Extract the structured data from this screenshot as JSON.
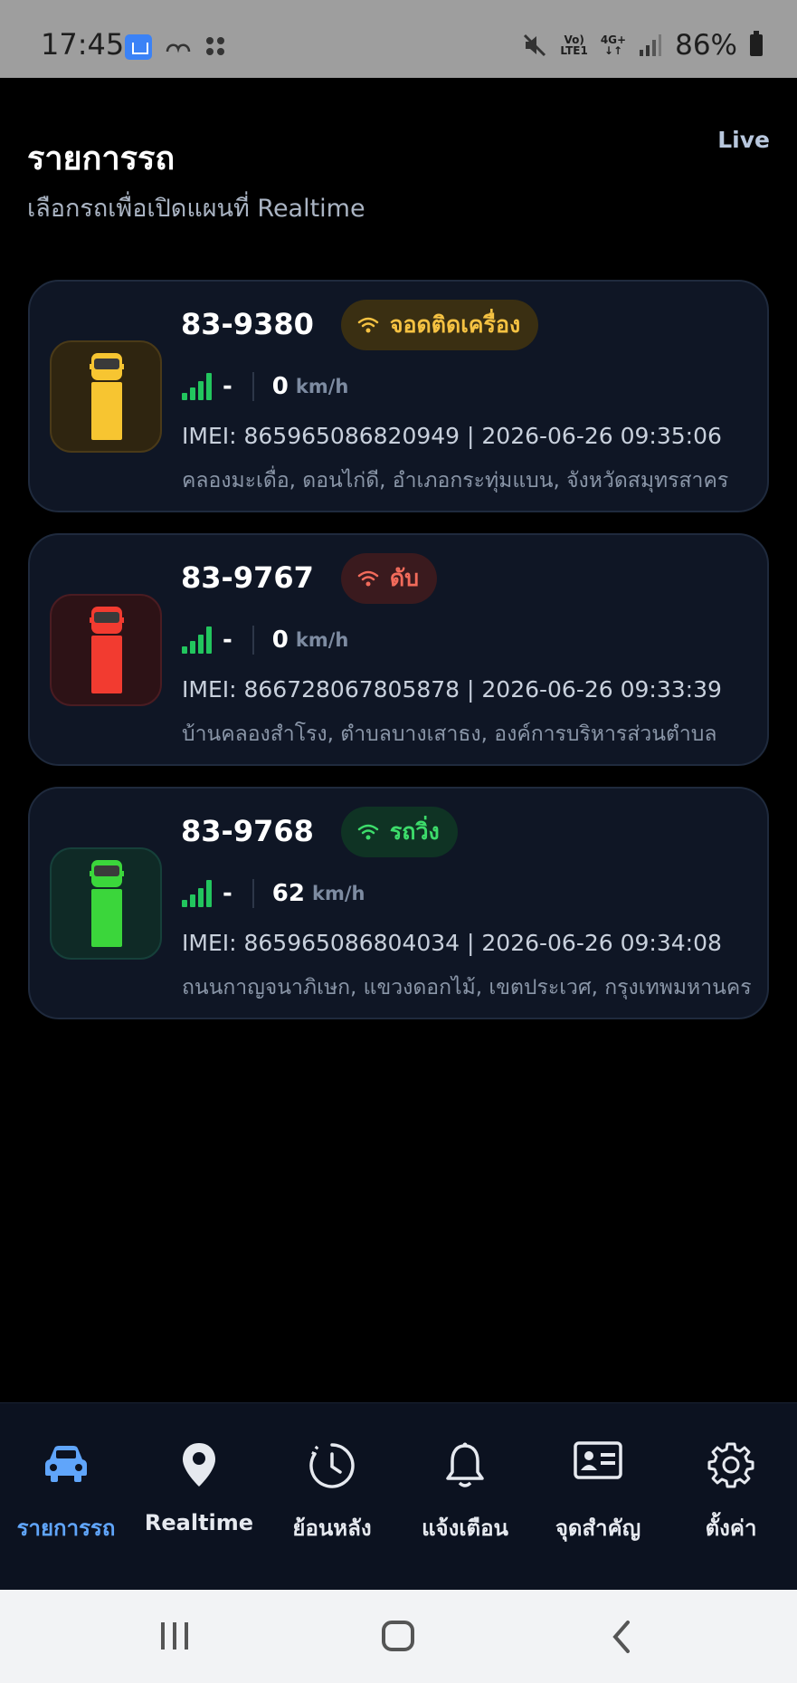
{
  "status_bar": {
    "time": "17:45",
    "network_top": "Vo)",
    "network_bottom": "LTE1",
    "network_type_top": "4G+",
    "network_type_bottom": "↓↑",
    "battery": "86%",
    "icons": [
      "home-app-icon",
      "cloud-icon",
      "dots-grid-icon",
      "mute-icon",
      "signal-icon",
      "battery-icon"
    ]
  },
  "header": {
    "title": "รายการรถ",
    "subtitle": "เลือกรถเพื่อเปิดแผนที่ Realtime",
    "live": "Live"
  },
  "vehicles": [
    {
      "plate": "83-9380",
      "status": "จอดติดเครื่อง",
      "status_color": "#f5c242",
      "badge_bg": "#3a2f12",
      "truck_color": "#f7c531",
      "thumb_bg": "#2f2510",
      "thumb_border": "#4a3a18",
      "signal": "-",
      "speed": "0",
      "speed_unit": "km/h",
      "imei_line": "IMEI: 865965086820949 | 2026-06-26 09:35:06",
      "address": "คลองมะเดื่อ, ดอนไก่ดี, อำเภอกระทุ่มแบน, จังหวัดสมุทรสาคร"
    },
    {
      "plate": "83-9767",
      "status": "ดับ",
      "status_color": "#f26b5b",
      "badge_bg": "#3a1a1e",
      "truck_color": "#f23b30",
      "thumb_bg": "#2d1216",
      "thumb_border": "#4a1c22",
      "signal": "-",
      "speed": "0",
      "speed_unit": "km/h",
      "imei_line": "IMEI: 866728067805878 | 2026-06-26 09:33:39",
      "address": "บ้านคลองสำโรง, ตำบลบางเสาธง, องค์การบริหารส่วนตำบล"
    },
    {
      "plate": "83-9768",
      "status": "รถวิ่ง",
      "status_color": "#3ddc6b",
      "badge_bg": "#0f3324",
      "truck_color": "#3bd63b",
      "thumb_bg": "#0f2a26",
      "thumb_border": "#16403a",
      "signal": "-",
      "speed": "62",
      "speed_unit": "km/h",
      "imei_line": "IMEI: 865965086804034 | 2026-06-26 09:34:08",
      "address": "ถนนกาญจนาภิเษก, แขวงดอกไม้, เขตประเวศ, กรุงเทพมหานคร"
    }
  ],
  "nav": [
    {
      "label": "รายการรถ",
      "icon": "car-icon",
      "active": true
    },
    {
      "label": "Realtime",
      "icon": "map-pin-icon",
      "active": false
    },
    {
      "label": "ย้อนหลัง",
      "icon": "history-clock-icon",
      "active": false
    },
    {
      "label": "แจ้งเตือน",
      "icon": "bell-icon",
      "active": false
    },
    {
      "label": "จุดสำคัญ",
      "icon": "id-card-icon",
      "active": false
    },
    {
      "label": "ตั้งค่า",
      "icon": "gear-icon",
      "active": false
    }
  ],
  "colors": {
    "background": "#000000",
    "card_bg": "#0f1625",
    "nav_bg": "#0c1220",
    "accent": "#60a5fa",
    "signal_green": "#22c55e"
  }
}
